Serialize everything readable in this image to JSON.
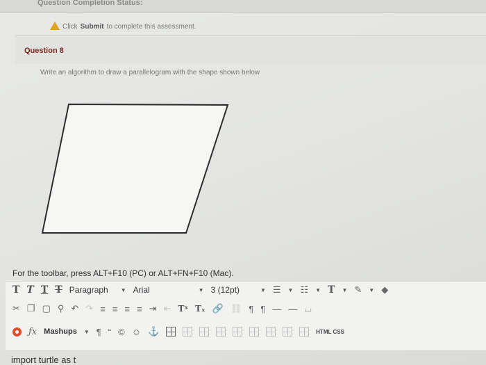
{
  "status": {
    "label": "Question Completion Status:"
  },
  "warning": {
    "prefix": "Click ",
    "strong": "Submit",
    "suffix": " to complete this assessment."
  },
  "question": {
    "title": "Question 8",
    "prompt": "Write an algorithm to draw a parallelogram with the shape shown below"
  },
  "toolbar": {
    "hint": "For the toolbar, press ALT+F10 (PC) or ALT+FN+F10 (Mac).",
    "format_buttons": [
      "T",
      "T",
      "T",
      "T"
    ],
    "paragraph": "Paragraph",
    "font": "Arial",
    "size": "3 (12pt)",
    "mashups": "Mashups",
    "html_css": "HTML CSS",
    "superscript": "Tˣ",
    "subscript": "Tₓ"
  },
  "editor": {
    "text": "import turtle as t"
  },
  "colors": {
    "warning": "#e2a21f",
    "question_title": "#7a2a1c",
    "mashup_dot": "#e04d2c"
  }
}
